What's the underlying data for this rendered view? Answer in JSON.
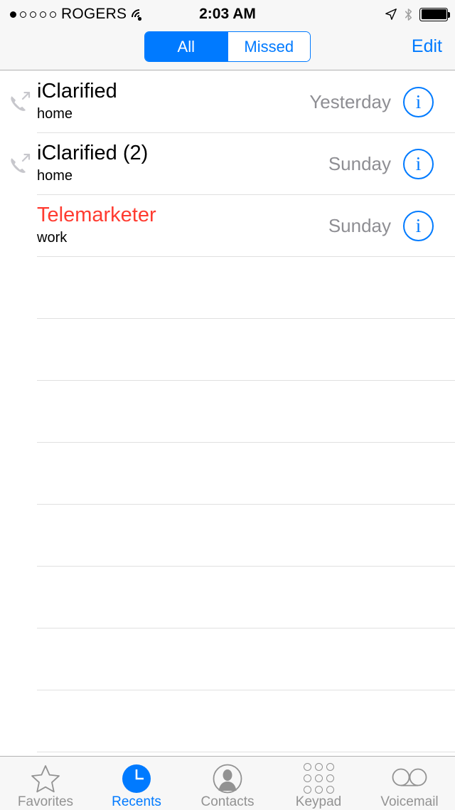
{
  "status_bar": {
    "signal_dots_total": 5,
    "signal_dots_filled": 1,
    "carrier": "ROGERS",
    "wifi_icon": "wifi-icon",
    "time": "2:03 AM",
    "location_icon": "location-arrow-icon",
    "bluetooth_icon": "bluetooth-icon",
    "battery_icon": "battery-full-icon",
    "battery_level_percent": 100
  },
  "nav_bar": {
    "segments": [
      {
        "label": "All",
        "selected": true
      },
      {
        "label": "Missed",
        "selected": false
      }
    ],
    "edit_label": "Edit"
  },
  "colors": {
    "accent_blue": "#007aff",
    "missed_red": "#ff3b30",
    "secondary_gray": "#8e8e93",
    "bar_background": "#f7f7f7",
    "separator": "#e0e0e0"
  },
  "calls": [
    {
      "name": "iClarified",
      "count": "",
      "label": "home",
      "time": "Yesterday",
      "missed": false,
      "call_type_icon": "outgoing-call-icon",
      "info_glyph": "i"
    },
    {
      "name": "iClarified",
      "count": "(2)",
      "label": "home",
      "time": "Sunday",
      "missed": false,
      "call_type_icon": "outgoing-call-icon",
      "info_glyph": "i"
    },
    {
      "name": "Telemarketer",
      "count": "",
      "label": "work",
      "time": "Sunday",
      "missed": true,
      "call_type_icon": "",
      "info_glyph": "i"
    }
  ],
  "empty_rows": 8,
  "tab_bar": {
    "tabs": [
      {
        "label": "Favorites",
        "icon": "star-icon",
        "active": false
      },
      {
        "label": "Recents",
        "icon": "clock-icon",
        "active": true
      },
      {
        "label": "Contacts",
        "icon": "person-icon",
        "active": false
      },
      {
        "label": "Keypad",
        "icon": "keypad-icon",
        "active": false
      },
      {
        "label": "Voicemail",
        "icon": "voicemail-icon",
        "active": false
      }
    ]
  }
}
